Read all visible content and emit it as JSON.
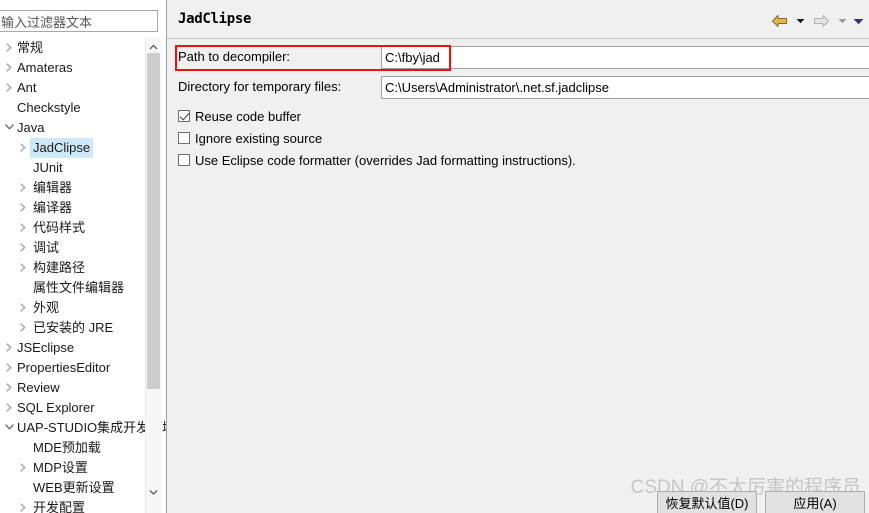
{
  "filter": {
    "placeholder": "输入过滤器文本",
    "value": ""
  },
  "tree": {
    "items": [
      {
        "label": "常规",
        "level": 0,
        "arrow": "collapsed",
        "selected": false
      },
      {
        "label": "Amateras",
        "level": 0,
        "arrow": "collapsed",
        "selected": false
      },
      {
        "label": "Ant",
        "level": 0,
        "arrow": "collapsed",
        "selected": false
      },
      {
        "label": "Checkstyle",
        "level": 0,
        "arrow": "none",
        "selected": false
      },
      {
        "label": "Java",
        "level": 0,
        "arrow": "expanded",
        "selected": false
      },
      {
        "label": "JadClipse",
        "level": 1,
        "arrow": "collapsed",
        "selected": true
      },
      {
        "label": "JUnit",
        "level": 1,
        "arrow": "none",
        "selected": false
      },
      {
        "label": "编辑器",
        "level": 1,
        "arrow": "collapsed",
        "selected": false
      },
      {
        "label": "编译器",
        "level": 1,
        "arrow": "collapsed",
        "selected": false
      },
      {
        "label": "代码样式",
        "level": 1,
        "arrow": "collapsed",
        "selected": false
      },
      {
        "label": "调试",
        "level": 1,
        "arrow": "collapsed",
        "selected": false
      },
      {
        "label": "构建路径",
        "level": 1,
        "arrow": "collapsed",
        "selected": false
      },
      {
        "label": "属性文件编辑器",
        "level": 1,
        "arrow": "none",
        "selected": false
      },
      {
        "label": "外观",
        "level": 1,
        "arrow": "collapsed",
        "selected": false
      },
      {
        "label": "已安装的 JRE",
        "level": 1,
        "arrow": "collapsed",
        "selected": false
      },
      {
        "label": "JSEclipse",
        "level": 0,
        "arrow": "collapsed",
        "selected": false
      },
      {
        "label": "PropertiesEditor",
        "level": 0,
        "arrow": "collapsed",
        "selected": false
      },
      {
        "label": "Review",
        "level": 0,
        "arrow": "collapsed",
        "selected": false
      },
      {
        "label": "SQL Explorer",
        "level": 0,
        "arrow": "collapsed",
        "selected": false
      },
      {
        "label": "UAP-STUDIO集成开发环境",
        "level": 0,
        "arrow": "expanded",
        "selected": false
      },
      {
        "label": "MDE预加载",
        "level": 1,
        "arrow": "none",
        "selected": false
      },
      {
        "label": "MDP设置",
        "level": 1,
        "arrow": "collapsed",
        "selected": false
      },
      {
        "label": "WEB更新设置",
        "level": 1,
        "arrow": "none",
        "selected": false
      },
      {
        "label": "开发配置",
        "level": 1,
        "arrow": "collapsed",
        "selected": false
      }
    ]
  },
  "scrollbar": {
    "up_icon": "chevron-up-icon",
    "down_icon": "chevron-down-icon"
  },
  "page": {
    "title": "JadClipse",
    "nav": {
      "back_icon": "back-arrow-icon",
      "back_dropdown_icon": "chevron-down-icon",
      "forward_icon": "forward-arrow-icon",
      "forward_dropdown_icon": "chevron-down-icon",
      "menu_dropdown_icon": "chevron-down-icon"
    },
    "fields": [
      {
        "label": "Path to decompiler:",
        "value": "C:\\fby\\jad"
      },
      {
        "label": "Directory for temporary files:",
        "value": "C:\\Users\\Administrator\\.net.sf.jadclipse"
      }
    ],
    "checkboxes": [
      {
        "label": "Reuse code buffer",
        "checked": true
      },
      {
        "label": "Ignore existing source",
        "checked": false
      },
      {
        "label": "Use Eclipse code formatter (overrides Jad formatting instructions).",
        "checked": false
      }
    ]
  },
  "annotation": {
    "color": "#ee1111"
  },
  "watermark": {
    "text": "CSDN @不太厉害的程序员"
  },
  "buttons": {
    "restore_defaults": "恢复默认值(D)",
    "apply": "应用(A)"
  },
  "colors": {
    "selection": "#cde8f7",
    "panel_bg": "#f0f0f0",
    "annotation_red": "#ee1111",
    "back_arrow": "#e8b44a",
    "forward_arrow": "#d8d8d8"
  }
}
